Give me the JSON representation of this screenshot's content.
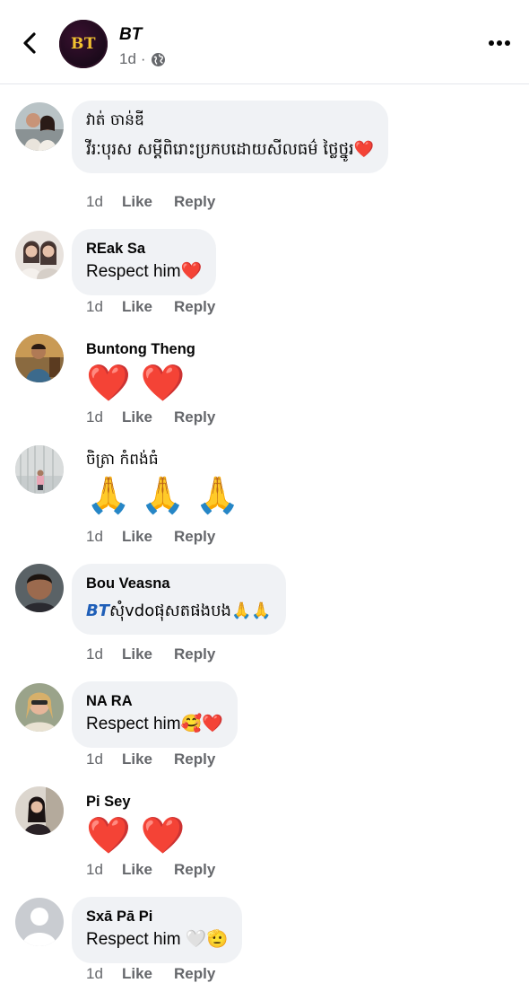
{
  "header": {
    "page_name": "BT",
    "page_logo_text": "BT",
    "post_time": "1d",
    "visibility_icon": "globe-icon",
    "back_icon": "chevron-left-icon",
    "more_icon": "more-horizontal-icon"
  },
  "actions": {
    "like_label": "Like",
    "reply_label": "Reply"
  },
  "comments": [
    {
      "author": "វាត់ ចាន់ឌី",
      "text": "វីរៈបុរស សម្តីពិរោះប្រកបដោយសីលធម៌ ថ្លៃថ្នូរ",
      "emoji": "❤️",
      "time": "1d"
    },
    {
      "author": "REak Sa",
      "text": "Respect him",
      "emoji": "❤️",
      "time": "1d"
    },
    {
      "author": "Buntong Theng",
      "text": "❤️ ❤️",
      "time": "1d"
    },
    {
      "author": "ចិត្រា កំពង់ធំ",
      "text": "🙏 🙏 🙏",
      "time": "1d"
    },
    {
      "author": "Bou Veasna",
      "mention": "BT",
      "text": "សុំvdoផុសតផងបង",
      "emoji": "🙏🙏",
      "time": "1d"
    },
    {
      "author": "NA RA",
      "text": "Respect him",
      "emoji": "🥰❤️",
      "time": "1d"
    },
    {
      "author": "Pi Sey",
      "text": "❤️ ❤️",
      "time": "1d"
    },
    {
      "author": "Sxā Pā Pi",
      "text": "Respect him",
      "emoji": "🤍🫡",
      "time": "1d"
    }
  ]
}
